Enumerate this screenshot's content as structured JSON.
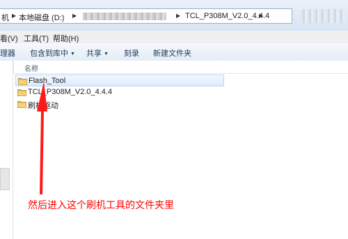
{
  "address_bar": {
    "segments": [
      "机",
      "本地磁盘 (D:)",
      "TCL_P308M_V2.0_4.4.4"
    ]
  },
  "menu": {
    "items": [
      "看(V)",
      "工具(T)",
      "帮助(H)"
    ]
  },
  "toolbar": {
    "organize": "理器",
    "include_in_library": "包含到库中",
    "share": "共享",
    "burn": "刻录",
    "new_folder": "新建文件夹"
  },
  "file_list": {
    "column_name": "名称",
    "items": [
      {
        "name": "Flash_Tool",
        "selected": true
      },
      {
        "name": "TCL_P308M_V2.0_4.4.4",
        "selected": false
      },
      {
        "name": "刷机驱动",
        "selected": false
      }
    ]
  },
  "annotation": {
    "text": "然后进入这个刷机工具的文件夹里",
    "color": "#ff0000"
  },
  "colors": {
    "folder": "#e8b94a",
    "selection": "#dcebfc",
    "annotation": "#ff0000"
  }
}
